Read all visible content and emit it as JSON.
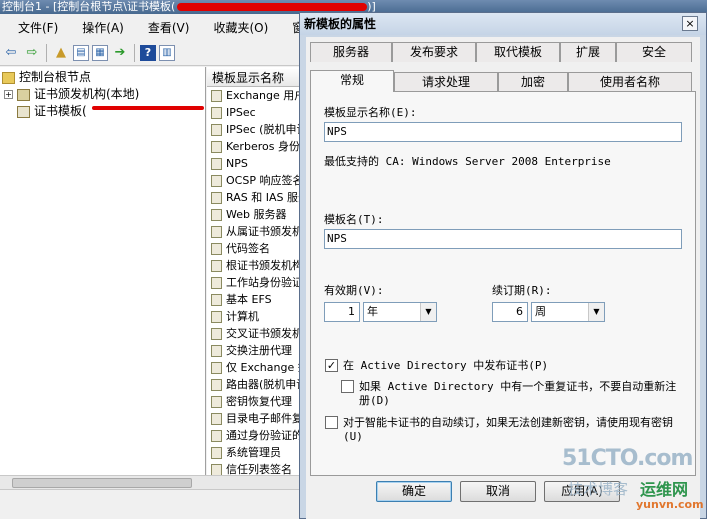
{
  "mmc": {
    "title": "控制台1 - [控制台根节点\\证书模板(",
    "title_suffix": ")]",
    "menu": [
      "文件(F)",
      "操作(A)",
      "查看(V)",
      "收藏夹(O)",
      "窗口(W)"
    ],
    "tree": {
      "root": "控制台根节点",
      "ca": "证书颁发机构(本地)",
      "templates": "证书模板("
    },
    "list_header": "模板显示名称",
    "list_items": [
      "Exchange 用户",
      "IPSec",
      "IPSec (脱机申请)",
      "Kerberos 身份验证",
      "NPS",
      "OCSP 响应签名",
      "RAS 和 IAS 服务器",
      "Web 服务器",
      "从属证书颁发机构",
      "代码签名",
      "根证书颁发机构",
      "工作站身份验证",
      "基本 EFS",
      "计算机",
      "交叉证书颁发机构",
      "交换注册代理",
      "仅 Exchange 签名",
      "路由器(脱机申请)",
      "密钥恢复代理",
      "目录电子邮件复制",
      "通过身份验证的会话",
      "系统管理员",
      "信任列表签名"
    ]
  },
  "dialog": {
    "title": "新模板的属性",
    "close": "×",
    "tabs_row1": [
      "服务器",
      "发布要求",
      "取代模板",
      "扩展",
      "安全"
    ],
    "tabs_row2": [
      "常规",
      "请求处理",
      "加密",
      "使用者名称"
    ],
    "active_tab": "常规",
    "display_name_label": "模板显示名称(E):",
    "display_name_value": "NPS",
    "min_ca_label": "最低支持的 CA:",
    "min_ca_value": "Windows Server 2008 Enterprise",
    "template_name_label": "模板名(T):",
    "template_name_value": "NPS",
    "validity_label": "有效期(V):",
    "validity_value": "1",
    "validity_unit": "年",
    "renewal_label": "续订期(R):",
    "renewal_value": "6",
    "renewal_unit": "周",
    "publish_ad": "在 Active Directory 中发布证书(P)",
    "no_auto_reenroll": "如果 Active Directory 中有一个重复证书，不要自动重新注册(D)",
    "smartcard_renew": "对于智能卡证书的自动续订，如果无法创建新密钥，请使用现有密钥(U)",
    "publish_ad_checked": true,
    "buttons": {
      "ok": "确定",
      "cancel": "取消",
      "apply": "应用(A)"
    }
  },
  "watermark": {
    "site": "51CTO.com",
    "tech": "技术博客",
    "brand": "运维网",
    "domain": "yunvn.com"
  }
}
